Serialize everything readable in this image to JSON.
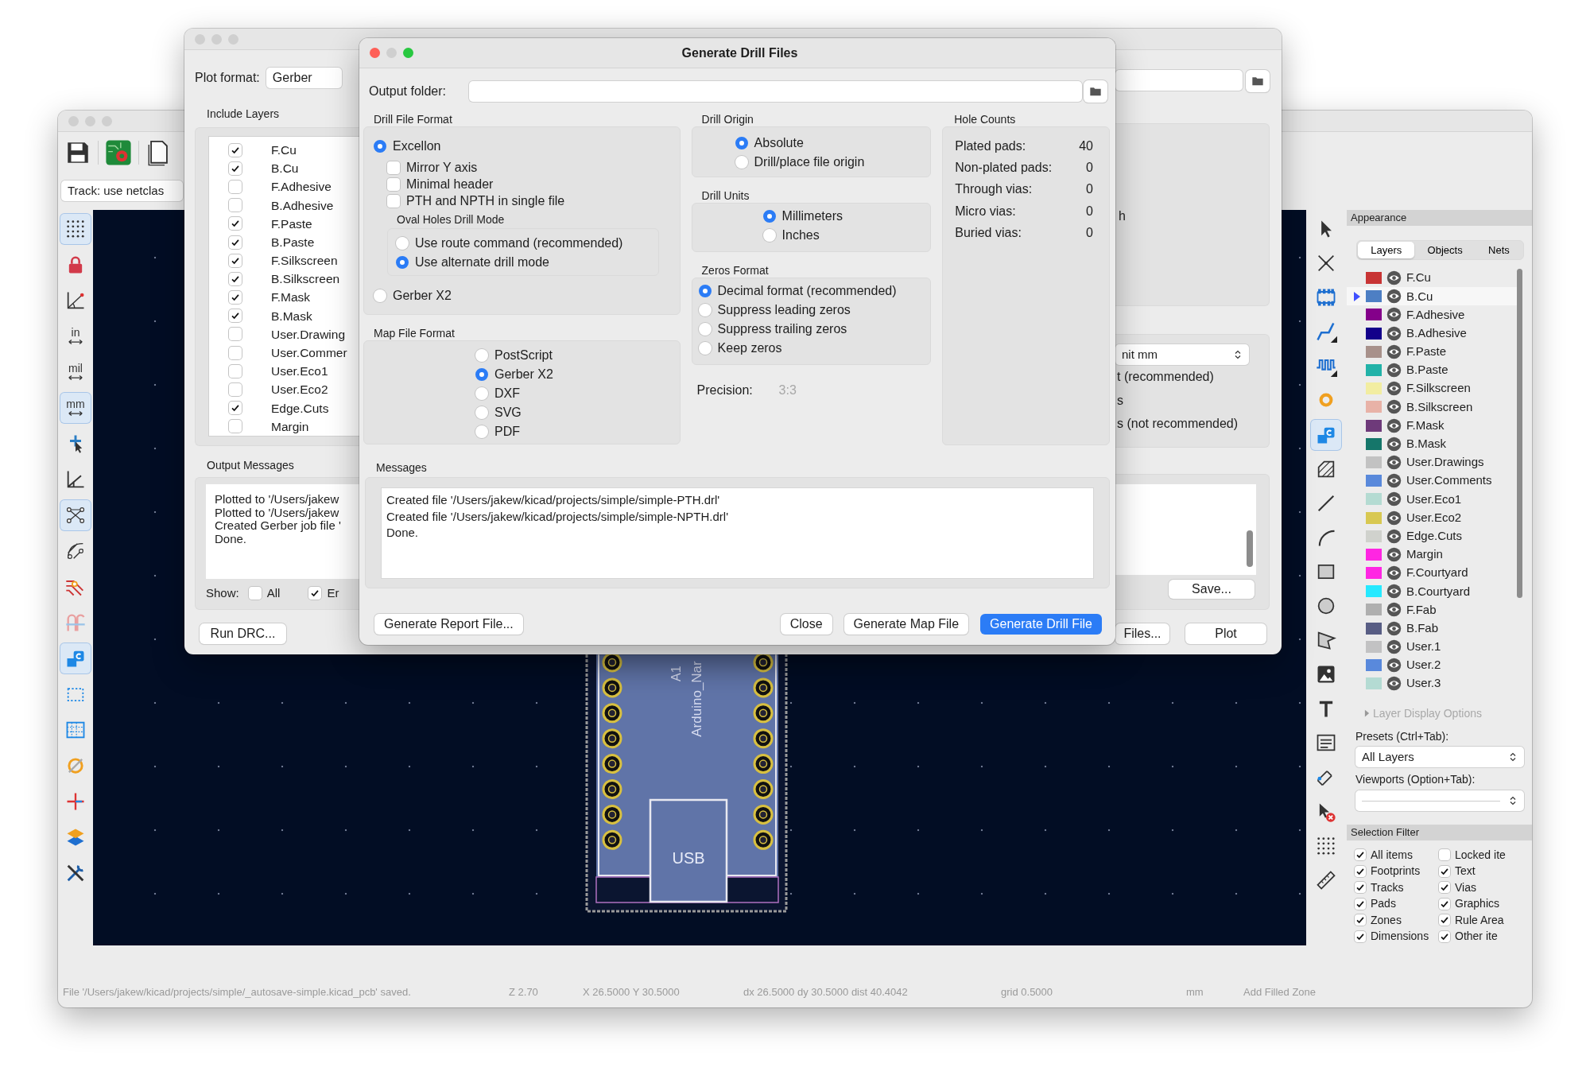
{
  "pcb_window": {
    "track_width": "Track: use netclas",
    "left_tools": [
      {
        "selected": true
      },
      {
        "selected": false
      },
      {
        "selected": false
      },
      {
        "label": "in",
        "selected": false
      },
      {
        "label": "mil",
        "selected": false
      },
      {
        "label": "mm",
        "selected": true
      },
      {
        "selected": false
      },
      {
        "selected": false
      },
      {
        "selected": true
      },
      {
        "selected": false
      },
      {
        "selected": false
      },
      {
        "selected": false
      },
      {
        "selected": true
      },
      {
        "selected": false
      },
      {
        "selected": false
      },
      {
        "selected": false
      },
      {
        "selected": false
      },
      {
        "selected": false
      },
      {
        "selected": false
      }
    ],
    "right_tools": [
      {
        "selected": false
      },
      {
        "selected": false
      },
      {
        "selected": false
      },
      {
        "selected": false
      },
      {
        "selected": false
      },
      {
        "selected": false
      },
      {
        "selected": true
      },
      {
        "selected": false
      },
      {
        "selected": false
      },
      {
        "selected": false
      },
      {
        "selected": false
      },
      {
        "selected": false
      },
      {
        "selected": false
      },
      {
        "selected": false
      },
      {
        "selected": false
      },
      {
        "selected": false
      },
      {
        "selected": false
      },
      {
        "selected": false
      },
      {
        "selected": false
      },
      {
        "selected": false
      }
    ],
    "board": {
      "reference": "A1",
      "value": "Arduino_Nar",
      "connector": "USB"
    },
    "appearance": {
      "title": "Appearance",
      "tabs": [
        {
          "label": "Layers",
          "selected": true
        },
        {
          "label": "Objects",
          "selected": false
        },
        {
          "label": "Nets",
          "selected": false
        }
      ],
      "layers": [
        {
          "name": "F.Cu",
          "color": "#c83434",
          "selected": false
        },
        {
          "name": "B.Cu",
          "color": "#4d7fc4",
          "selected": true
        },
        {
          "name": "F.Adhesive",
          "color": "#84008a",
          "selected": false
        },
        {
          "name": "B.Adhesive",
          "color": "#13008a",
          "selected": false
        },
        {
          "name": "F.Paste",
          "color": "#a8918b",
          "selected": false
        },
        {
          "name": "B.Paste",
          "color": "#22b2a8",
          "selected": false
        },
        {
          "name": "F.Silkscreen",
          "color": "#f2eda1",
          "selected": false
        },
        {
          "name": "B.Silkscreen",
          "color": "#e8b2a7",
          "selected": false
        },
        {
          "name": "F.Mask",
          "color": "#6e3a7a",
          "selected": false
        },
        {
          "name": "B.Mask",
          "color": "#15766a",
          "selected": false
        },
        {
          "name": "User.Drawings",
          "color": "#c2c2c2",
          "selected": false
        },
        {
          "name": "User.Comments",
          "color": "#5989db",
          "selected": false
        },
        {
          "name": "User.Eco1",
          "color": "#b4dbd2",
          "selected": false
        },
        {
          "name": "User.Eco2",
          "color": "#d8c852",
          "selected": false
        },
        {
          "name": "Edge.Cuts",
          "color": "#d0d2cd",
          "selected": false
        },
        {
          "name": "Margin",
          "color": "#ff26e2",
          "selected": false
        },
        {
          "name": "F.Courtyard",
          "color": "#ff26e3",
          "selected": false
        },
        {
          "name": "B.Courtyard",
          "color": "#26e9ff",
          "selected": false
        },
        {
          "name": "F.Fab",
          "color": "#afafaf",
          "selected": false
        },
        {
          "name": "B.Fab",
          "color": "#585d84",
          "selected": false
        },
        {
          "name": "User.1",
          "color": "#c2c2c3",
          "selected": false
        },
        {
          "name": "User.2",
          "color": "#5989dc",
          "selected": false
        },
        {
          "name": "User.3",
          "color": "#b4dbd3",
          "selected": false
        }
      ],
      "display_options": "Layer Display Options",
      "presets_label": "Presets (Ctrl+Tab):",
      "preset": "All Layers",
      "viewports_label": "Viewports (Option+Tab):"
    },
    "selection_filter": {
      "title": "Selection Filter",
      "items": [
        {
          "label": "All items",
          "checked": true
        },
        {
          "label": "Locked ite",
          "checked": false
        },
        {
          "label": "Footprints",
          "checked": true
        },
        {
          "label": "Text",
          "checked": true
        },
        {
          "label": "Tracks",
          "checked": true
        },
        {
          "label": "Vias",
          "checked": true
        },
        {
          "label": "Pads",
          "checked": true
        },
        {
          "label": "Graphics",
          "checked": true
        },
        {
          "label": "Zones",
          "checked": true
        },
        {
          "label": "Rule Area",
          "checked": true
        },
        {
          "label": "Dimensions",
          "checked": true
        },
        {
          "label": "Other ite",
          "checked": true
        }
      ]
    },
    "status_bar": [
      "File '/Users/jakew/kicad/projects/simple/_autosave-simple.kicad_pcb' saved.",
      "Z 2.70",
      "X 26.5000  Y 30.5000",
      "dx 26.5000  dy 30.5000  dist 40.4042",
      "grid 0.5000",
      "mm",
      "Add Filled Zone"
    ]
  },
  "plot_dialog": {
    "format_label": "Plot format:",
    "format": "Gerber",
    "layers_title": "Include Layers",
    "layers": [
      {
        "name": "F.Cu",
        "checked": true
      },
      {
        "name": "B.Cu",
        "checked": true
      },
      {
        "name": "F.Adhesive",
        "checked": false
      },
      {
        "name": "B.Adhesive",
        "checked": false
      },
      {
        "name": "F.Paste",
        "checked": true
      },
      {
        "name": "B.Paste",
        "checked": true
      },
      {
        "name": "F.Silkscreen",
        "checked": true
      },
      {
        "name": "B.Silkscreen",
        "checked": true
      },
      {
        "name": "F.Mask",
        "checked": true
      },
      {
        "name": "B.Mask",
        "checked": true
      },
      {
        "name": "User.Drawing",
        "checked": false
      },
      {
        "name": "User.Commer",
        "checked": false
      },
      {
        "name": "User.Eco1",
        "checked": false
      },
      {
        "name": "User.Eco2",
        "checked": false
      },
      {
        "name": "Edge.Cuts",
        "checked": true
      },
      {
        "name": "Margin",
        "checked": false
      }
    ],
    "messages_title": "Output Messages",
    "messages": [
      "Plotted to '/Users/jakew",
      "Plotted to '/Users/jakew",
      "Created Gerber job file '",
      "Done."
    ],
    "show_label": "Show:",
    "show_filters": [
      {
        "label": "All",
        "checked": false
      },
      {
        "label": "Er",
        "checked": true
      }
    ],
    "run_drc": "Run DRC...",
    "fragment": "h",
    "unit_dropdown": "nit mm",
    "fragments": [
      "t (recommended)",
      "s",
      "s (not recommended)"
    ],
    "save": "Save...",
    "buttons": [
      "Files...",
      "Plot"
    ]
  },
  "drill_dialog": {
    "title": "Generate Drill Files",
    "output_folder_label": "Output folder:",
    "drill_file_format": {
      "title": "Drill File Format",
      "formats": [
        {
          "label": "Excellon",
          "selected": true
        },
        {
          "label": "Gerber X2",
          "selected": false
        }
      ],
      "options": [
        {
          "label": "Mirror Y axis",
          "checked": false
        },
        {
          "label": "Minimal header",
          "checked": false
        },
        {
          "label": "PTH and NPTH in single file",
          "checked": false
        }
      ],
      "oval_title": "Oval Holes Drill Mode",
      "oval_modes": [
        {
          "label": "Use route command (recommended)",
          "selected": false
        },
        {
          "label": "Use alternate drill mode",
          "selected": true
        }
      ]
    },
    "map_file_format": {
      "title": "Map File Format",
      "options": [
        {
          "label": "PostScript",
          "selected": false
        },
        {
          "label": "Gerber X2",
          "selected": true
        },
        {
          "label": "DXF",
          "selected": false
        },
        {
          "label": "SVG",
          "selected": false
        },
        {
          "label": "PDF",
          "selected": false
        }
      ]
    },
    "drill_origin": {
      "title": "Drill Origin",
      "options": [
        {
          "label": "Absolute",
          "selected": true
        },
        {
          "label": "Drill/place file origin",
          "selected": false
        }
      ]
    },
    "drill_units": {
      "title": "Drill Units",
      "options": [
        {
          "label": "Millimeters",
          "selected": true
        },
        {
          "label": "Inches",
          "selected": false
        }
      ]
    },
    "zeros_format": {
      "title": "Zeros Format",
      "options": [
        {
          "label": "Decimal format (recommended)",
          "selected": true
        },
        {
          "label": "Suppress leading zeros",
          "selected": false
        },
        {
          "label": "Suppress trailing zeros",
          "selected": false
        },
        {
          "label": "Keep zeros",
          "selected": false
        }
      ]
    },
    "precision": {
      "label": "Precision:",
      "value": "3:3"
    },
    "hole_counts": {
      "title": "Hole Counts",
      "rows": [
        {
          "label": "Plated pads:",
          "value": "40"
        },
        {
          "label": "Non-plated pads:",
          "value": "0"
        },
        {
          "label": "Through vias:",
          "value": "0"
        },
        {
          "label": "Micro vias:",
          "value": "0"
        },
        {
          "label": "Buried vias:",
          "value": "0"
        }
      ]
    },
    "messages": {
      "title": "Messages",
      "lines": [
        "Created file '/Users/jakew/kicad/projects/simple/simple-PTH.drl'",
        "Created file '/Users/jakew/kicad/projects/simple/simple-NPTH.drl'",
        "Done."
      ]
    },
    "buttons": [
      {
        "label": "Generate Report File...",
        "primary": false
      },
      {
        "label": "Close",
        "primary": false
      },
      {
        "label": "Generate Map File",
        "primary": false
      },
      {
        "label": "Generate Drill File",
        "primary": true
      }
    ]
  }
}
